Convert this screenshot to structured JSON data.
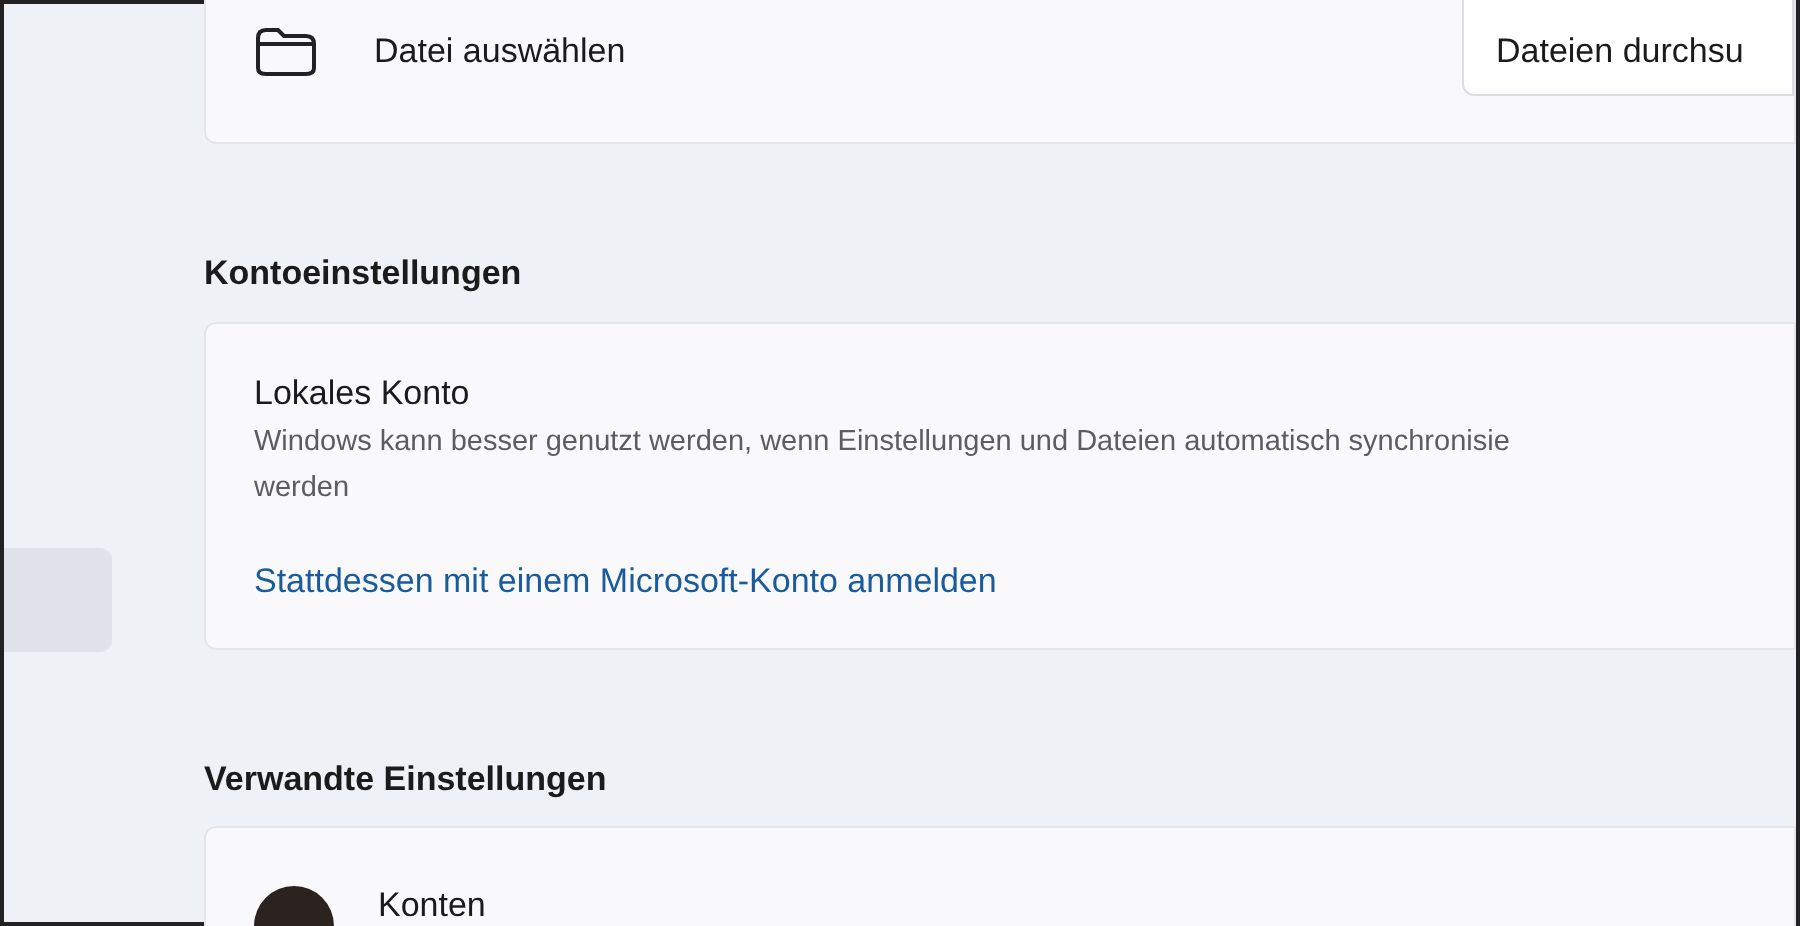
{
  "file_card": {
    "label": "Datei auswählen",
    "button": "Dateien durchsu"
  },
  "account_settings": {
    "heading": "Kontoeinstellungen",
    "title": "Lokales Konto",
    "description": "Windows kann besser genutzt werden, wenn Einstellungen und Dateien automatisch synchronisie werden",
    "link": "Stattdessen mit einem Microsoft-Konto anmelden"
  },
  "related_settings": {
    "heading": "Verwandte Einstellungen",
    "items": [
      {
        "label": "Konten"
      }
    ]
  },
  "sidebar": {
    "items": [
      {
        "selected": true
      }
    ]
  }
}
